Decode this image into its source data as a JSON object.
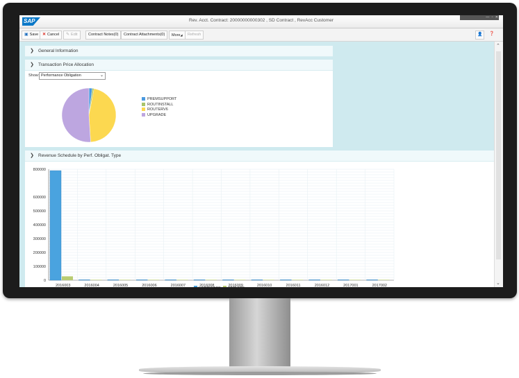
{
  "window": {
    "title": "Rev. Acct. Contract: 20000000000302 , SD Contract , RevAcc Customer",
    "controls": "— ▫ ✕",
    "logo_text": "SAP"
  },
  "toolbar": {
    "save_label": "Save",
    "cancel_label": "Cancel",
    "edit_label": "Edit",
    "contract_notes_label": "Contract Notes(0)",
    "contract_attachments_label": "Contract Attachments(0)",
    "more_label": "More",
    "refresh_label": "Refresh",
    "user_icon": "👤",
    "help_icon": "❓"
  },
  "sections": {
    "general_info": {
      "title": "General Information"
    },
    "tpa": {
      "title": "Transaction Price Allocation",
      "show_label": "Show:",
      "show_value": "Performance Obligation"
    },
    "revenue": {
      "title": "Revenue Schedule by Perf. Obligat. Type"
    }
  },
  "colors": {
    "accent": "#0a78c8",
    "content_bg": "#cfeaef",
    "hardware": "#4aa3df",
    "service": "#b9cc72",
    "premsupport": "#4b9ae0",
    "routinstall": "#a9c46a",
    "routerv6": "#fcd850",
    "upgrade": "#bda6e0"
  },
  "chart_data": [
    {
      "type": "pie",
      "categories": [
        "PREMSUPPORT",
        "ROUTINSTALL",
        "ROUTERV6",
        "UPGRADE"
      ],
      "values": [
        2,
        1,
        46,
        51
      ]
    },
    {
      "type": "bar",
      "categories": [
        "2016003",
        "2016004",
        "2016005",
        "2016006",
        "2016007",
        "2016008",
        "2016009",
        "2016010",
        "2016011",
        "2016012",
        "2017001",
        "2017002"
      ],
      "ylim": [
        0,
        800000
      ],
      "yticks": [
        "0",
        "100000",
        "200000",
        "300000",
        "400000",
        "500000",
        "600000",
        "800000"
      ],
      "series": [
        {
          "name": "HARDWARE",
          "values": [
            790000,
            0,
            0,
            0,
            0,
            0,
            0,
            0,
            0,
            0,
            0,
            0
          ]
        },
        {
          "name": "SERVICE",
          "values": [
            28000,
            2000,
            2000,
            2000,
            2000,
            2000,
            2000,
            2000,
            2000,
            2000,
            2000,
            2000
          ]
        }
      ],
      "grid": true,
      "legend": "bottom"
    }
  ]
}
